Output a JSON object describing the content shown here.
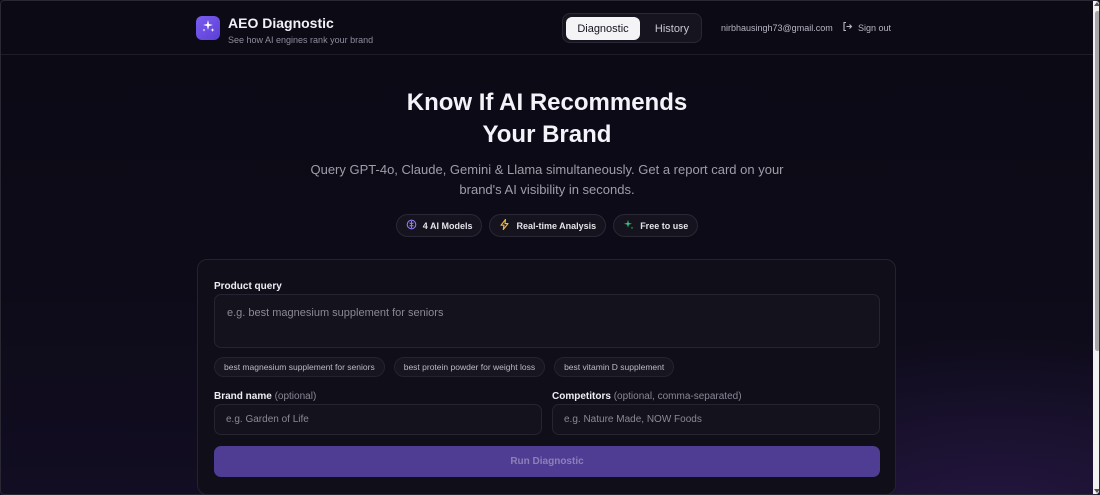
{
  "header": {
    "app_title": "AEO Diagnostic",
    "app_subtitle": "See how AI engines rank your brand",
    "logo_icon": "sparkles-icon",
    "nav": {
      "diagnostic_label": "Diagnostic",
      "history_label": "History",
      "active": "Diagnostic"
    },
    "user_email": "nirbhausingh73@gmail.com",
    "signout_label": "Sign out"
  },
  "hero": {
    "title_line1": "Know If AI Recommends",
    "title_line2": "Your Brand",
    "subtitle_line1": "Query GPT-4o, Claude, Gemini & Llama simultaneously. Get a report card on your",
    "subtitle_line2": "brand's AI visibility in seconds.",
    "badges": [
      {
        "label": "4 AI Models",
        "icon": "brain-icon",
        "color": "#8b7cf6"
      },
      {
        "label": "Real-time Analysis",
        "icon": "lightning-icon",
        "color": "#f5b83d"
      },
      {
        "label": "Free to use",
        "icon": "sparkles-icon",
        "color": "#35c97a"
      }
    ]
  },
  "form": {
    "product_query_label": "Product query",
    "product_query_placeholder": "e.g. best magnesium supplement for seniors",
    "suggestions": [
      "best magnesium supplement for seniors",
      "best protein powder for weight loss",
      "best vitamin D supplement"
    ],
    "brand_label": "Brand name",
    "brand_optional": "(optional)",
    "brand_placeholder": "e.g. Garden of Life",
    "competitors_label": "Competitors",
    "competitors_optional": "(optional, comma-separated)",
    "competitors_placeholder": "e.g. Nature Made, NOW Foods",
    "run_button_label": "Run Diagnostic"
  },
  "colors": {
    "accent": "#7c5cf0",
    "button": "#4f3d94",
    "background": "#0c0a14"
  }
}
